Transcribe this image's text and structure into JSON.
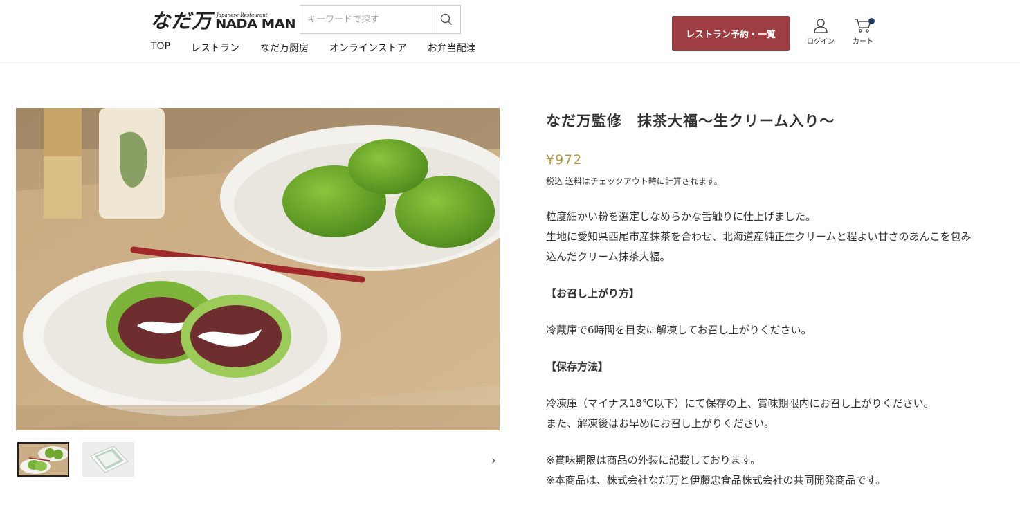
{
  "header": {
    "logo_jp": "なだ万",
    "logo_en_small": "Japanese Restaurant",
    "logo_en": "NADA MAN",
    "search": {
      "placeholder": "キーワードで探す"
    },
    "nav": [
      "TOP",
      "レストラン",
      "なだ万厨房",
      "オンラインストア",
      "お弁当配達"
    ],
    "reserve_label": "レストラン予約・一覧",
    "login_label": "ログイン",
    "cart_label": "カート"
  },
  "product": {
    "title": "なだ万監修　抹茶大福～生クリーム入り～",
    "price": "¥972",
    "tax_note": "税込 送料はチェックアウト時に計算されます。",
    "description": {
      "line1": "粒度細かい粉を選定しなめらかな舌触りに仕上げました。",
      "line2": "生地に愛知県西尾市産抹茶を合わせ、北海道産純正生クリームと程よい甘さのあんこを包み",
      "line3": "込んだクリーム抹茶大福。",
      "heading_serve": "【お召し上がり方】",
      "serve_text": "冷蔵庫で6時間を目安に解凍してお召し上がりください。",
      "heading_storage": "【保存方法】",
      "storage_line1": "冷凍庫（マイナス18℃以下）にて保存の上、賞味期限内にお召し上がりください。",
      "storage_line2": "また、解凍後はお早めにお召し上がりください。",
      "note1": "※賞味期限は商品の外装に記載しております。",
      "note2": "※本商品は、株式会社なだ万と伊藤忠食品株式会社の共同開発商品です。"
    }
  },
  "gallery": {
    "next_arrow": "›"
  },
  "colors": {
    "accent_button": "#9e3e42",
    "price": "#b49544",
    "cart_badge": "#1f3a5f"
  }
}
